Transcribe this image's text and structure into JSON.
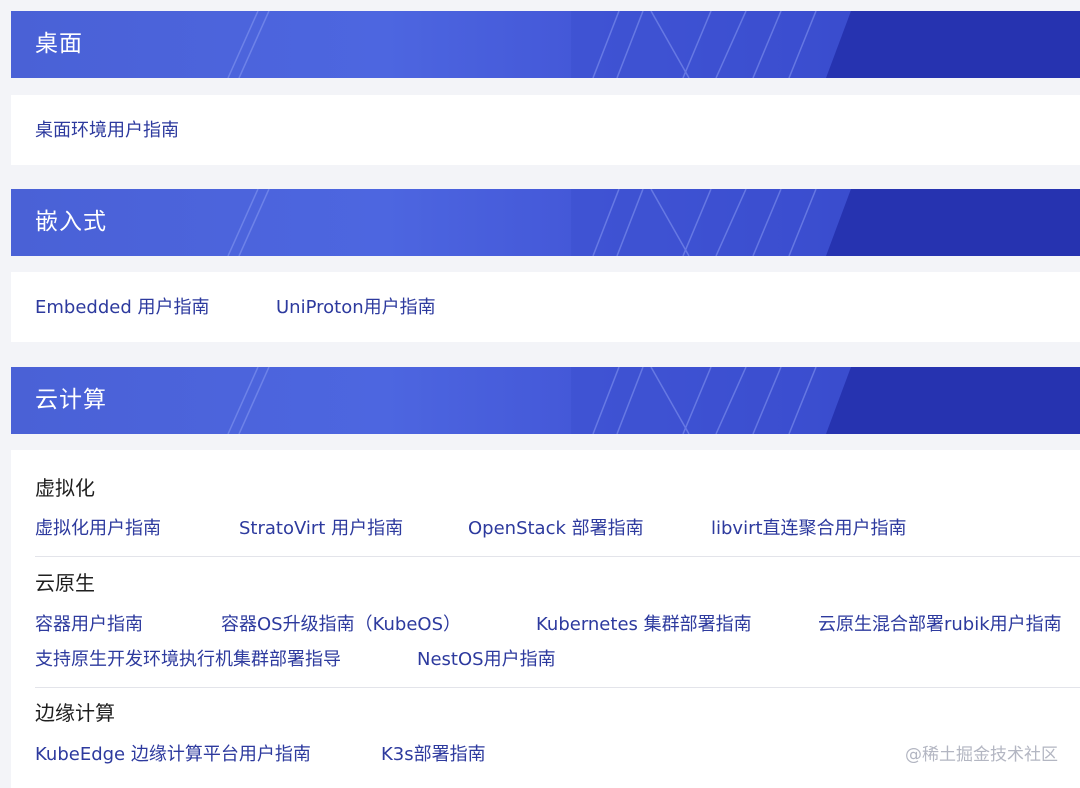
{
  "sections": [
    {
      "title": "桌面",
      "links": [
        "桌面环境用户指南"
      ]
    },
    {
      "title": "嵌入式",
      "links": [
        "Embedded 用户指南",
        "UniProton用户指南"
      ]
    },
    {
      "title": "云计算",
      "groups": [
        {
          "name": "虚拟化",
          "links": [
            "虚拟化用户指南",
            "StratoVirt 用户指南",
            "OpenStack 部署指南",
            "libvirt直连聚合用户指南"
          ]
        },
        {
          "name": "云原生",
          "links": [
            "容器用户指南",
            "容器OS升级指南（KubeOS）",
            "Kubernetes 集群部署指南",
            "云原生混合部署rubik用户指南",
            "支持原生开发环境执行机集群部署指导",
            "NestOS用户指南"
          ]
        },
        {
          "name": "边缘计算",
          "links": [
            "KubeEdge 边缘计算平台用户指南",
            "K3s部署指南"
          ]
        }
      ]
    }
  ],
  "watermark": "@稀土掘金技术社区",
  "colors": {
    "header_start": "#4a61d6",
    "header_end": "#2a37b8",
    "link": "#2d3a9e",
    "page_bg": "#f3f4f8"
  }
}
